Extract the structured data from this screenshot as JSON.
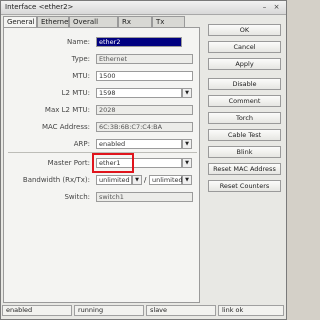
{
  "window": {
    "title": "Interface <ether2>",
    "minimize_glyph": "–",
    "close_glyph": "×"
  },
  "tabs": [
    "General",
    "Ethernet",
    "Overall Stats",
    "Rx Stats",
    "Tx Stats"
  ],
  "form": {
    "name": {
      "label": "Name:",
      "value": "ether2"
    },
    "type": {
      "label": "Type:",
      "value": "Ethernet"
    },
    "mtu": {
      "label": "MTU:",
      "value": "1500"
    },
    "l2mtu": {
      "label": "L2 MTU:",
      "value": "1598"
    },
    "max_l2mtu": {
      "label": "Max L2 MTU:",
      "value": "2028"
    },
    "mac": {
      "label": "MAC Address:",
      "value": "6C:3B:6B:C7:C4:BA"
    },
    "arp": {
      "label": "ARP:",
      "value": "enabled"
    },
    "master_port": {
      "label": "Master Port:",
      "value": "ether1"
    },
    "bandwidth": {
      "label": "Bandwidth (Rx/Tx):",
      "rx": "unlimited",
      "separator": "/",
      "tx": "unlimited"
    },
    "switch": {
      "label": "Switch:",
      "value": "switch1"
    }
  },
  "buttons": [
    "OK",
    "Cancel",
    "Apply",
    "Disable",
    "Comment",
    "Torch",
    "Cable Test",
    "Blink",
    "Reset MAC Address",
    "Reset Counters"
  ],
  "status": [
    "enabled",
    "running",
    "slave",
    "link ok"
  ],
  "icons": {
    "dropdown": "triangle-down-icon"
  },
  "colors": {
    "highlight": "#e0141c",
    "selection": "#000080"
  }
}
